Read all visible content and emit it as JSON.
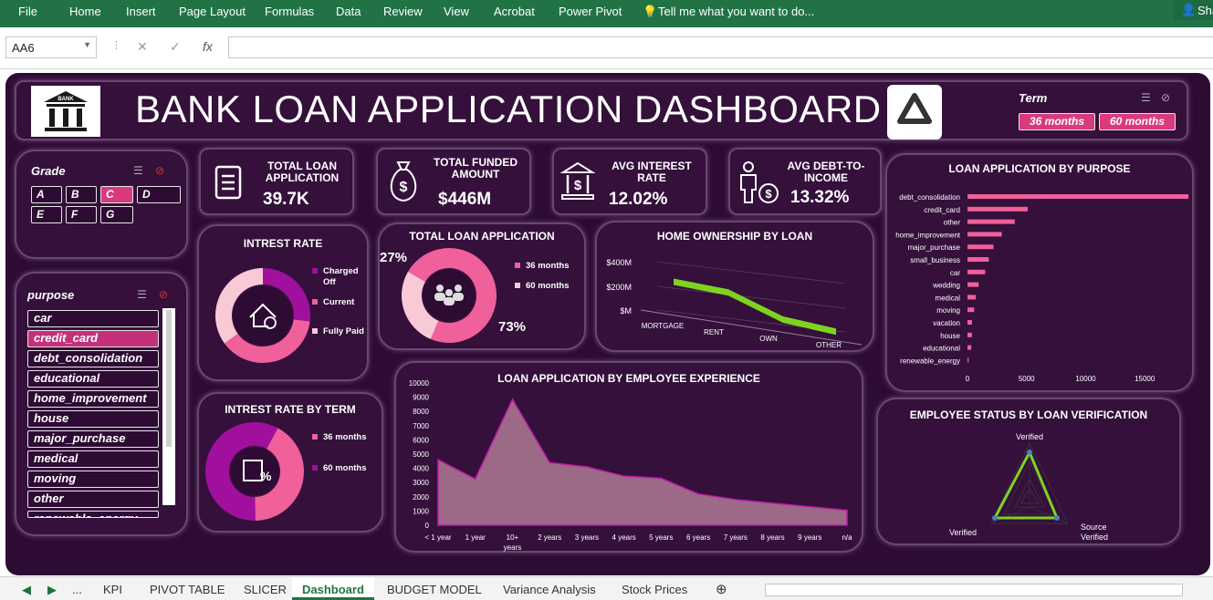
{
  "ribbon": {
    "file": "File",
    "home": "Home",
    "insert": "Insert",
    "page_layout": "Page Layout",
    "formulas": "Formulas",
    "data": "Data",
    "review": "Review",
    "view": "View",
    "acrobat": "Acrobat",
    "power_pivot": "Power Pivot",
    "tell_me": "Tell me what you want to do...",
    "share": "Sha"
  },
  "formula_bar": {
    "name_box": "AA6",
    "fx": "fx",
    "cancel": "✕",
    "enter": "✓"
  },
  "dashboard": {
    "title": "BANK LOAN APPLICATION DASHBOARD",
    "bank_logo_text": "BANK",
    "term_slicer": {
      "title": "Term",
      "items": [
        "36 months",
        "60 months"
      ]
    },
    "grade_slicer": {
      "title": "Grade",
      "items": [
        "A",
        "B",
        "C",
        "D",
        "E",
        "F",
        "G"
      ],
      "selected": "C"
    },
    "purpose_slicer": {
      "title": "purpose",
      "items": [
        "car",
        "credit_card",
        "debt_consolidation",
        "educational",
        "home_improvement",
        "house",
        "major_purchase",
        "medical",
        "moving",
        "other",
        "renewable_energy"
      ],
      "selected": "credit_card"
    },
    "kpis": [
      {
        "label": "TOTAL LOAN APPLICATION",
        "value": "39.7K",
        "icon": "document-icon"
      },
      {
        "label": "TOTAL FUNDED AMOUNT",
        "value": "$446M",
        "icon": "money-bag-icon"
      },
      {
        "label": "AVG INTEREST RATE",
        "value": "12.02%",
        "icon": "bank-icon"
      },
      {
        "label": "AVG DEBT-TO-INCOME",
        "value": "13.32%",
        "icon": "person-dollar-icon"
      }
    ],
    "colors": {
      "bg": "#2d0b33",
      "panel": "#34103b",
      "pink": "#f0609b",
      "purple": "#a0109c",
      "light_pink": "#f9c9d6",
      "green": "#7ed321",
      "magenta_sel": "#d93a7e"
    }
  },
  "chart_data": [
    {
      "type": "pie",
      "title": "INTREST RATE",
      "donut": true,
      "categories": [
        "Charged Off",
        "Current",
        "Fully Paid"
      ],
      "values": [
        27,
        38,
        35
      ],
      "colors": [
        "#a0109c",
        "#f0609b",
        "#f9c9d6"
      ]
    },
    {
      "type": "pie",
      "title": "TOTAL LOAN APPLICATION",
      "donut": true,
      "categories": [
        "36 months",
        "60 months"
      ],
      "values": [
        73,
        27
      ],
      "data_labels": [
        "73%",
        "27%"
      ],
      "colors": [
        "#f0609b",
        "#f9c9d6"
      ]
    },
    {
      "type": "line",
      "title": "HOME OWNERSHIP BY LOAN",
      "categories": [
        "MORTGAGE",
        "RENT",
        "OWN",
        "OTHER"
      ],
      "values": [
        210,
        185,
        40,
        5
      ],
      "yticks": [
        "$400M",
        "$200M",
        "$M"
      ],
      "ylim": [
        0,
        400
      ]
    },
    {
      "type": "bar",
      "orientation": "horizontal",
      "title": "LOAN APPLICATION BY PURPOSE",
      "categories": [
        "debt_consolidation",
        "credit_card",
        "other",
        "home_improvement",
        "major_purchase",
        "small_business",
        "car",
        "wedding",
        "medical",
        "moving",
        "vacation",
        "house",
        "educational",
        "renewable_energy"
      ],
      "values": [
        18700,
        5100,
        4000,
        2900,
        2200,
        1800,
        1500,
        950,
        700,
        560,
        380,
        370,
        320,
        100
      ],
      "xticks": [
        "0",
        "5000",
        "10000",
        "15000"
      ],
      "xlim": [
        0,
        19000
      ]
    },
    {
      "type": "pie",
      "title": "INTREST RATE BY TERM",
      "donut": true,
      "categories": [
        "36 months",
        "60 months"
      ],
      "values": [
        42,
        58
      ],
      "colors": [
        "#f0609b",
        "#a0109c"
      ]
    },
    {
      "type": "area",
      "title": "LOAN APPLICATION BY EMPLOYEE EXPERIENCE",
      "categories": [
        "< 1 year",
        "1 year",
        "10+ years",
        "2 years",
        "3 years",
        "4 years",
        "5 years",
        "6 years",
        "7 years",
        "8 years",
        "9 years",
        "n/a"
      ],
      "values": [
        4600,
        3250,
        8850,
        4400,
        4100,
        3450,
        3300,
        2200,
        1800,
        1550,
        1300,
        1050
      ],
      "yticks": [
        "0",
        "1000",
        "2000",
        "3000",
        "4000",
        "5000",
        "6000",
        "7000",
        "8000",
        "9000",
        "10000"
      ],
      "ylim": [
        0,
        10000
      ]
    },
    {
      "type": "radar",
      "title": "EMPLOYEE STATUS BY LOAN VERIFICATION",
      "categories": [
        "Verified",
        "Source Verified",
        "Verified"
      ],
      "category_labels": {
        "top": "Verified",
        "right": "Source Verified",
        "left": "Verified"
      }
    }
  ],
  "sheet_tabs": {
    "items": [
      "KPI",
      "PIVOT TABLE",
      "SLICER",
      "Dashboard",
      "BUDGET MODEL",
      "Variance Analysis",
      "Stock Prices"
    ],
    "active": "Dashboard",
    "ellipsis": "..."
  }
}
